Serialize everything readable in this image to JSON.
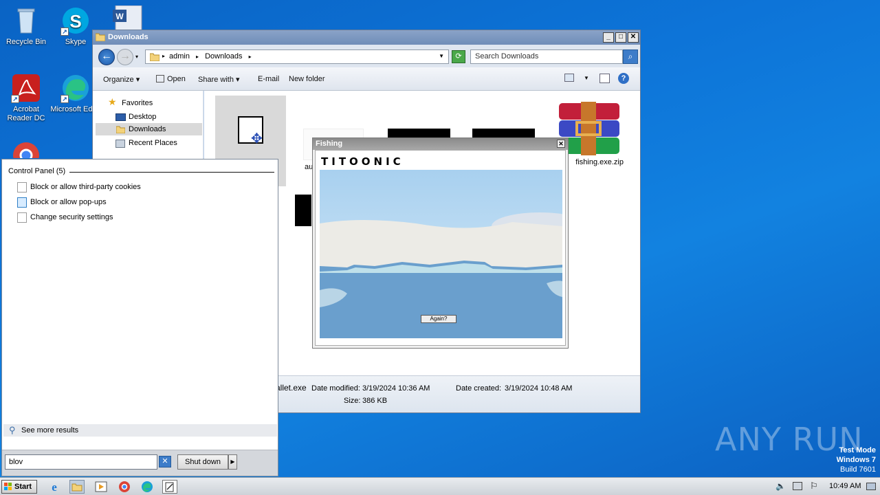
{
  "desktop": {
    "icons": [
      {
        "label": "Recycle Bin"
      },
      {
        "label": "Skype"
      },
      {
        "label": "Acrobat Reader DC"
      },
      {
        "label": "Microsoft Edge"
      }
    ],
    "watermark": "ANY RUN",
    "test_mode": {
      "line1": "Test Mode",
      "line2": "Windows 7",
      "line3": "Build 7601"
    }
  },
  "explorer": {
    "title": "Downloads",
    "breadcrumb": [
      "admin",
      "Downloads"
    ],
    "search_placeholder": "Search Downloads",
    "toolbar": {
      "organize": "Organize",
      "open": "Open",
      "share_with": "Share with",
      "email": "E-mail",
      "new_folder": "New folder"
    },
    "nav": {
      "favorites": "Favorites",
      "desktop": "Desktop",
      "downloads": "Downloads",
      "recent": "Recent Places"
    },
    "files": [
      {
        "name": "au"
      },
      {
        "name": "fishing.exe.zip"
      }
    ],
    "details": {
      "filename": "allet.exe",
      "date_modified_label": "Date modified:",
      "date_modified": "3/19/2024 10:36 AM",
      "date_created_label": "Date created:",
      "date_created": "3/19/2024 10:48 AM",
      "size_label": "Size:",
      "size": "386 KB"
    }
  },
  "start_menu": {
    "group_header": "Control Panel (5)",
    "items": [
      {
        "label": "Block or allow third-party cookies"
      },
      {
        "label": "Block or allow pop-ups"
      },
      {
        "label": "Change security settings"
      }
    ],
    "see_more": "See more results",
    "search_value": "blov",
    "shutdown": "Shut down"
  },
  "fishing": {
    "title": "Fishing",
    "logo": "TITOONIC",
    "again_button": "Again?"
  },
  "taskbar": {
    "start": "Start",
    "clock": "10:49 AM"
  }
}
